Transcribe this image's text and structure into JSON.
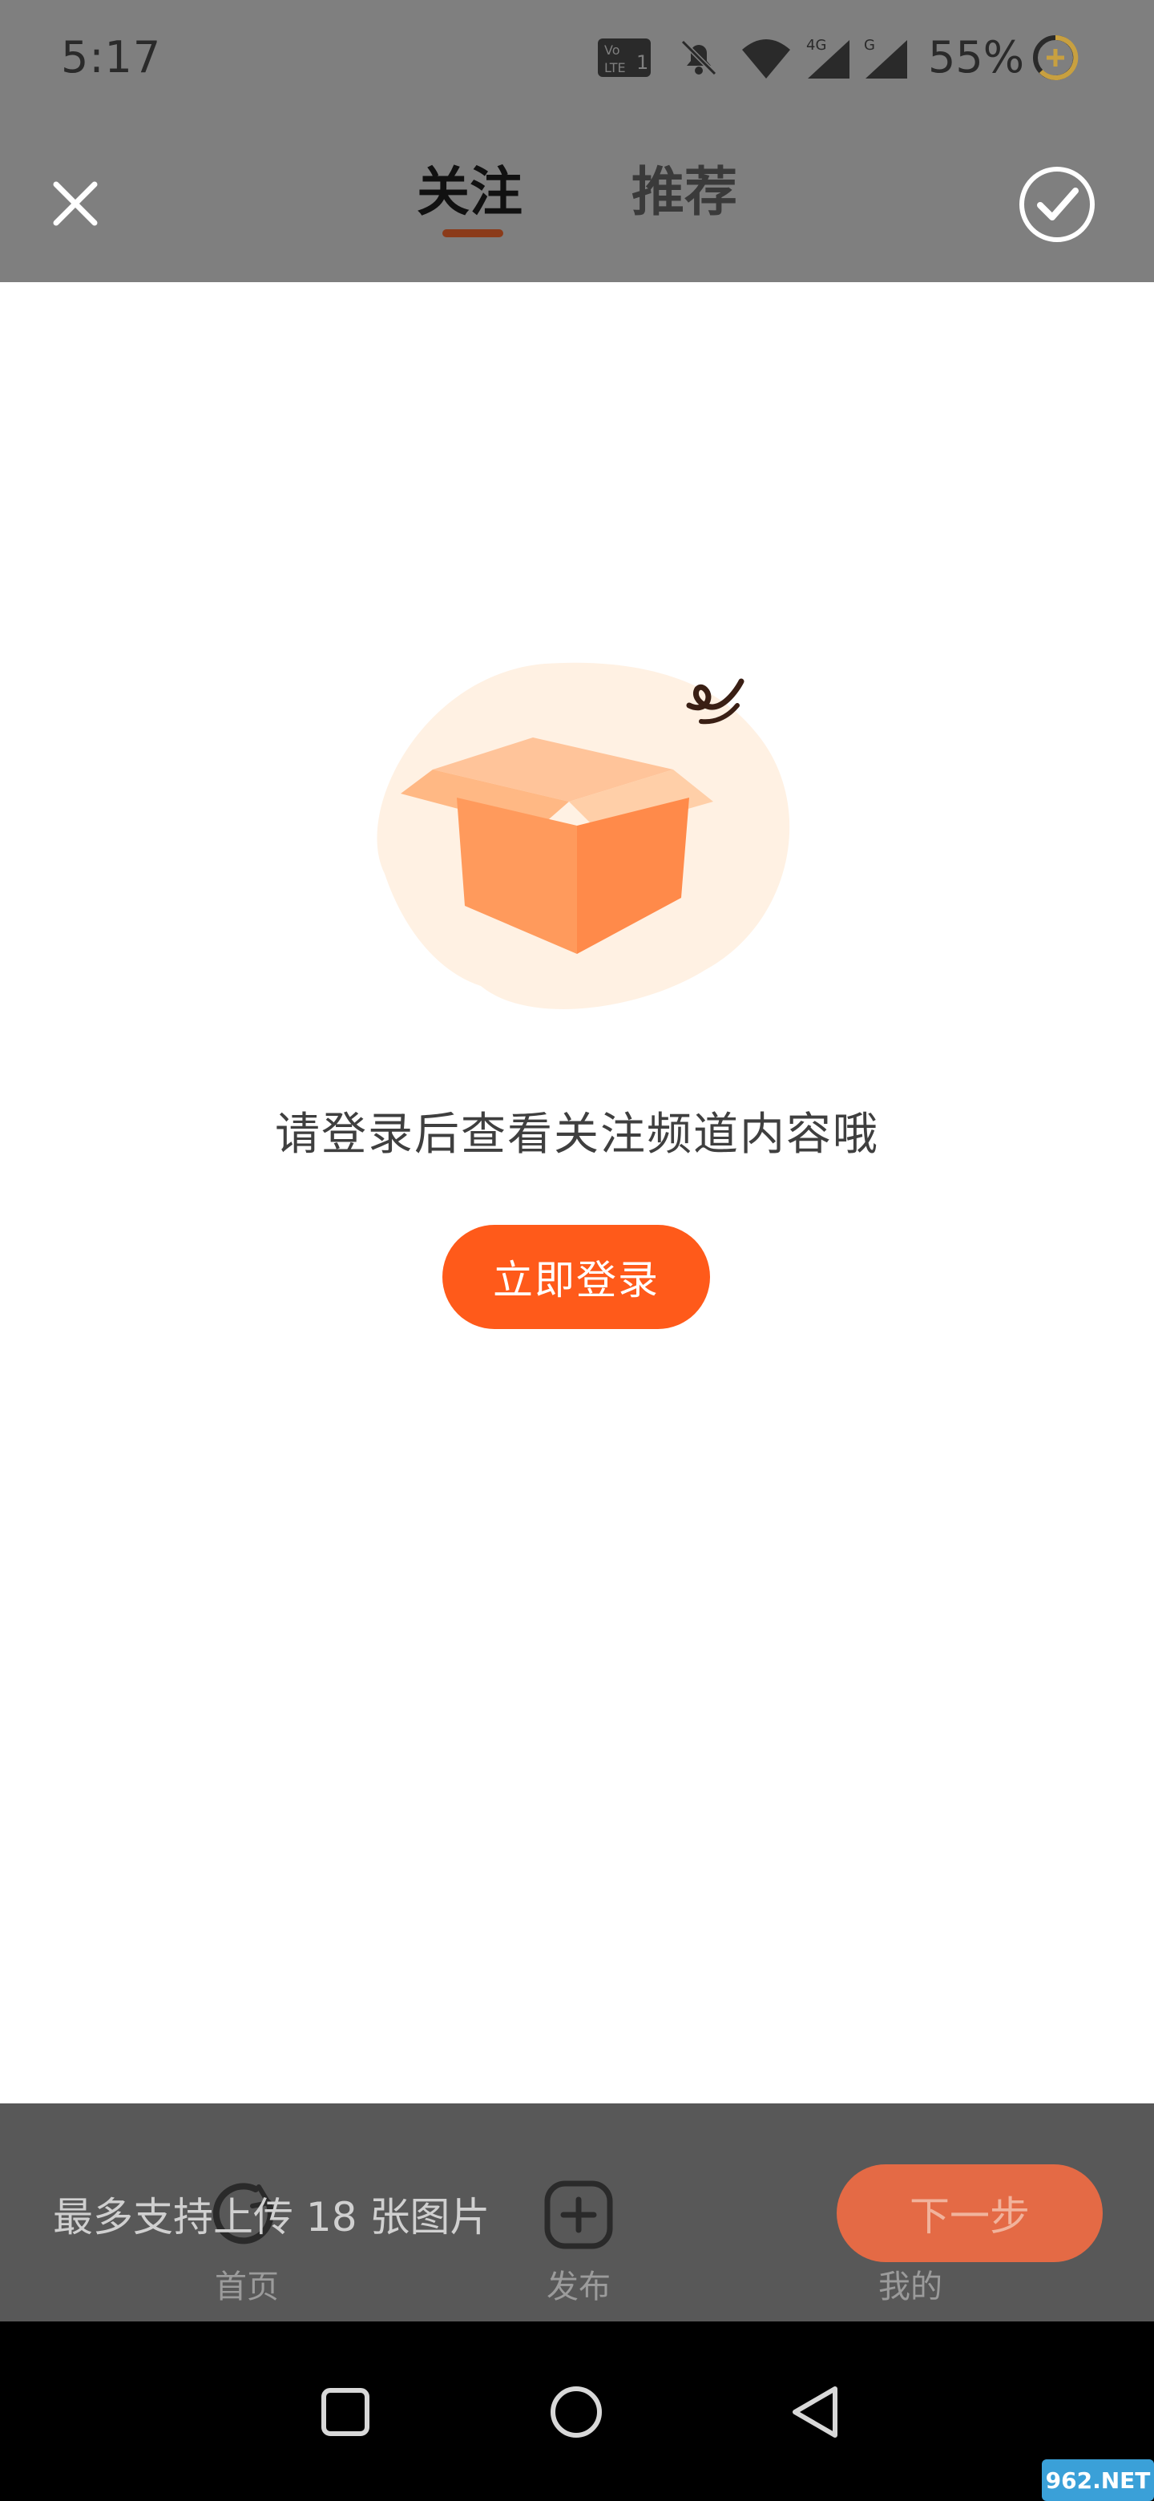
{
  "status_bar": {
    "time": "5:17",
    "network_4g": "4G",
    "network_g": "G",
    "battery_percent": "55%",
    "icons": [
      "volte-icon",
      "bell-off-icon",
      "wifi-icon",
      "signal-4g-icon",
      "signal-g-icon",
      "battery-ring-icon"
    ]
  },
  "header": {
    "tabs": [
      {
        "label": "关注",
        "active": true
      },
      {
        "label": "推荐",
        "active": false
      }
    ],
    "close_icon": "close-icon",
    "confirm_icon": "check-circle-icon"
  },
  "empty_state": {
    "illustration": "open-box-illustration",
    "message": "请登录后查看关注频道内容哦",
    "login_button": "立即登录"
  },
  "bottom_panel": {
    "upload_hint": "最多支持上传 18 张图片",
    "next_button": "下一步"
  },
  "bottom_nav": {
    "items": [
      {
        "label": "首页",
        "icon": "home-icon"
      },
      {
        "label": "发布",
        "icon": "plus-square-icon"
      },
      {
        "label": "我的",
        "icon": "profile-icon"
      }
    ]
  },
  "system_nav": {
    "buttons": [
      "recents-square-icon",
      "home-circle-icon",
      "back-triangle-icon"
    ]
  },
  "watermark": "962.NET",
  "colors": {
    "accent": "#ff5a1a",
    "overlay": "#7f7f7f",
    "next_button": "#e46a45"
  }
}
